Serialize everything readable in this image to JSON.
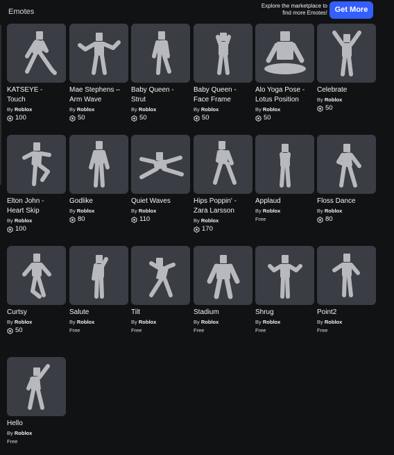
{
  "header": {
    "section_label": "Emotes",
    "promo_line1": "Explore the marketplace to",
    "promo_line2": "find more Emotes!",
    "cta_label": "Get More"
  },
  "colors": {
    "background": "#111214",
    "card": "#3b3d44",
    "figure": "#b7b9be",
    "accent": "#335fff"
  },
  "emotes": [
    {
      "name": "KATSEYE -\nTouch",
      "by": "By",
      "creator": "Roblox",
      "price": "100",
      "free": false,
      "pose": "touch",
      "icon": "robux-icon"
    },
    {
      "name": "Mae Stephens –\nArm Wave",
      "by": "By",
      "creator": "Roblox",
      "price": "50",
      "free": false,
      "pose": "armwave",
      "icon": "robux-icon"
    },
    {
      "name": "Baby Queen -\nStrut",
      "by": "By",
      "creator": "Roblox",
      "price": "50",
      "free": false,
      "pose": "strut",
      "icon": "robux-icon"
    },
    {
      "name": "Baby Queen -\nFace Frame",
      "by": "By",
      "creator": "Roblox",
      "price": "50",
      "free": false,
      "pose": "faceframe",
      "icon": "robux-icon"
    },
    {
      "name": "Alo Yoga Pose -\nLotus Position",
      "by": "By",
      "creator": "Roblox",
      "price": "50",
      "free": false,
      "pose": "lotus",
      "icon": "robux-icon"
    },
    {
      "name": "Celebrate",
      "by": "By",
      "creator": "Roblox",
      "price": "50",
      "free": false,
      "pose": "celebrate",
      "icon": "robux-icon"
    },
    {
      "name": "Elton John -\nHeart Skip",
      "by": "By",
      "creator": "Roblox",
      "price": "100",
      "free": false,
      "pose": "heartskip",
      "icon": "robux-icon"
    },
    {
      "name": "Godlike",
      "by": "By",
      "creator": "Roblox",
      "price": "80",
      "free": false,
      "pose": "godlike",
      "icon": "robux-icon"
    },
    {
      "name": "Quiet Waves",
      "by": "By",
      "creator": "Roblox",
      "price": "110",
      "free": false,
      "pose": "quietwaves",
      "icon": "robux-icon"
    },
    {
      "name": "Hips Poppin' -\nZara Larsson",
      "by": "By",
      "creator": "Roblox",
      "price": "170",
      "free": false,
      "pose": "hips",
      "icon": "robux-icon"
    },
    {
      "name": "Applaud",
      "by": "By",
      "creator": "Roblox",
      "price": "Free",
      "free": true,
      "pose": "applaud",
      "icon": ""
    },
    {
      "name": "Floss Dance",
      "by": "By",
      "creator": "Roblox",
      "price": "80",
      "free": false,
      "pose": "floss",
      "icon": "robux-icon"
    },
    {
      "name": "Curtsy",
      "by": "By",
      "creator": "Roblox",
      "price": "50",
      "free": false,
      "pose": "curtsy",
      "icon": "robux-icon"
    },
    {
      "name": "Salute",
      "by": "By",
      "creator": "Roblox",
      "price": "Free",
      "free": true,
      "pose": "salute",
      "icon": ""
    },
    {
      "name": "Tilt",
      "by": "By",
      "creator": "Roblox",
      "price": "Free",
      "free": true,
      "pose": "tilt",
      "icon": ""
    },
    {
      "name": "Stadium",
      "by": "By",
      "creator": "Roblox",
      "price": "Free",
      "free": true,
      "pose": "stadium",
      "icon": ""
    },
    {
      "name": "Shrug",
      "by": "By",
      "creator": "Roblox",
      "price": "Free",
      "free": true,
      "pose": "shrug",
      "icon": ""
    },
    {
      "name": "Point2",
      "by": "By",
      "creator": "Roblox",
      "price": "Free",
      "free": true,
      "pose": "point",
      "icon": ""
    },
    {
      "name": "Hello",
      "by": "By",
      "creator": "Roblox",
      "price": "Free",
      "free": true,
      "pose": "hello",
      "icon": ""
    }
  ]
}
